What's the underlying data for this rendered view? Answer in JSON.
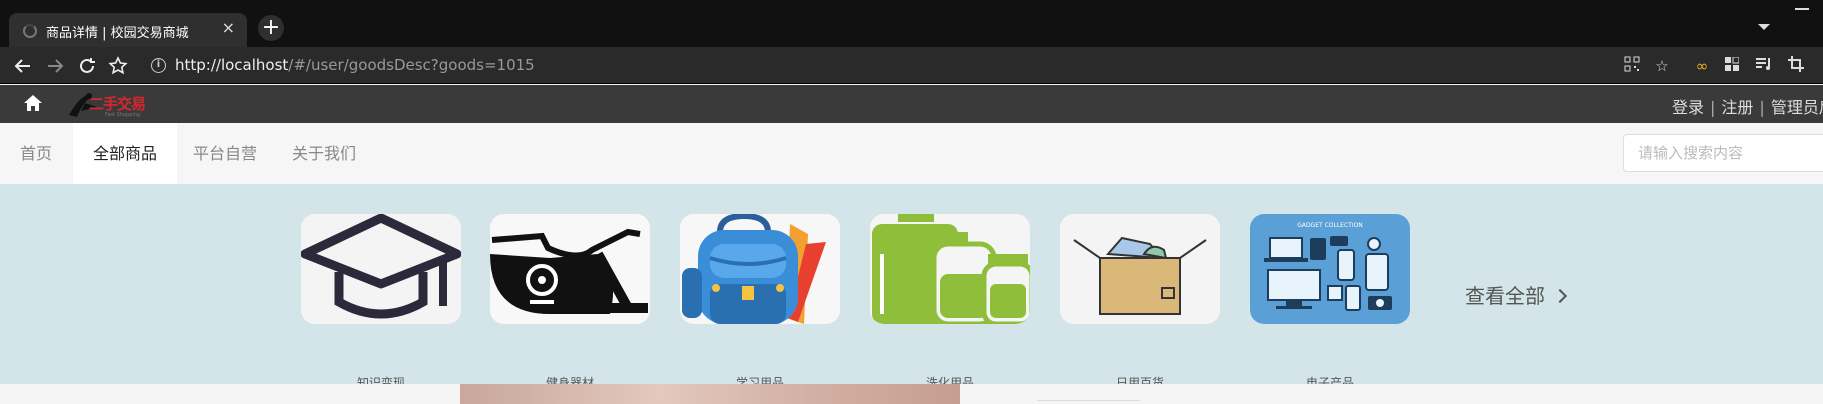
{
  "browser": {
    "tab_title": "商品详情 | 校园交易商城",
    "tab_close": "×",
    "new_tab": "+",
    "address_host": "http://localhost",
    "address_path": "/#/user/goodsDesc?goods=1015"
  },
  "header": {
    "logo_text": "二手交易",
    "logo_subtext": "Fast Shopping",
    "auth": [
      "登录",
      "注册",
      "管理员后"
    ]
  },
  "nav": {
    "items": [
      "首页",
      "全部商品",
      "平台自营",
      "关于我们"
    ],
    "active_index": 1,
    "search_placeholder": "请输入搜索内容"
  },
  "categories": {
    "items": [
      {
        "label": "知识变现",
        "icon": "graduation-cap-icon"
      },
      {
        "label": "健身器材",
        "icon": "exercise-bike-icon"
      },
      {
        "label": "学习用品",
        "icon": "backpack-icon"
      },
      {
        "label": "洗化用品",
        "icon": "bottles-icon"
      },
      {
        "label": "日用百货",
        "icon": "box-icon"
      },
      {
        "label": "电子产品",
        "icon": "gadgets-icon",
        "caption": "GADGET COLLECTION"
      }
    ],
    "view_all": "查看全部"
  },
  "colors": {
    "header_bg": "#3a3a3a",
    "category_band_bg": "#d3e5e8",
    "logo_red": "#d7282f",
    "bottles_green": "#8fbf3a",
    "gadgets_blue": "#5a9fd6"
  }
}
